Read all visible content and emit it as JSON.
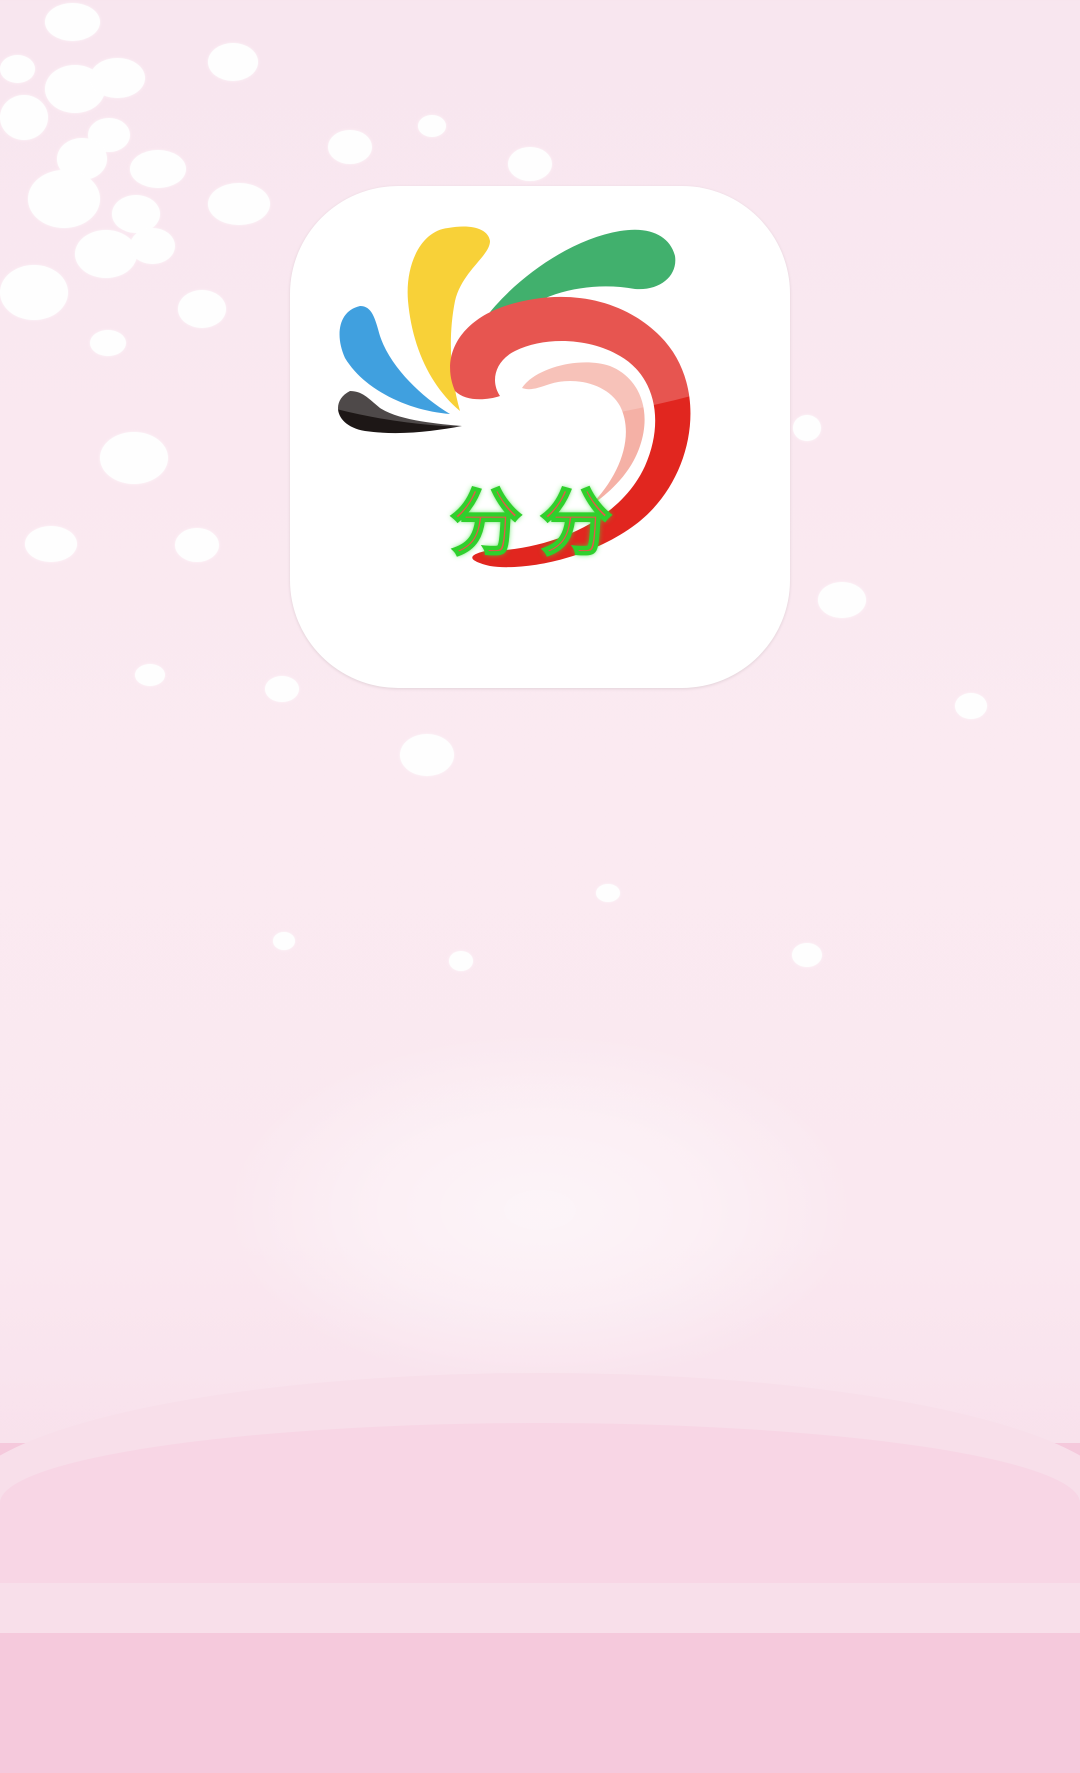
{
  "app_name": "分分",
  "icon": {
    "name": "fenfen-app-icon",
    "colors": {
      "blue": "#0b86d6",
      "yellow": "#f7c400",
      "green": "#0c9a45",
      "red": "#e1261f",
      "black": "#1d1716"
    }
  }
}
